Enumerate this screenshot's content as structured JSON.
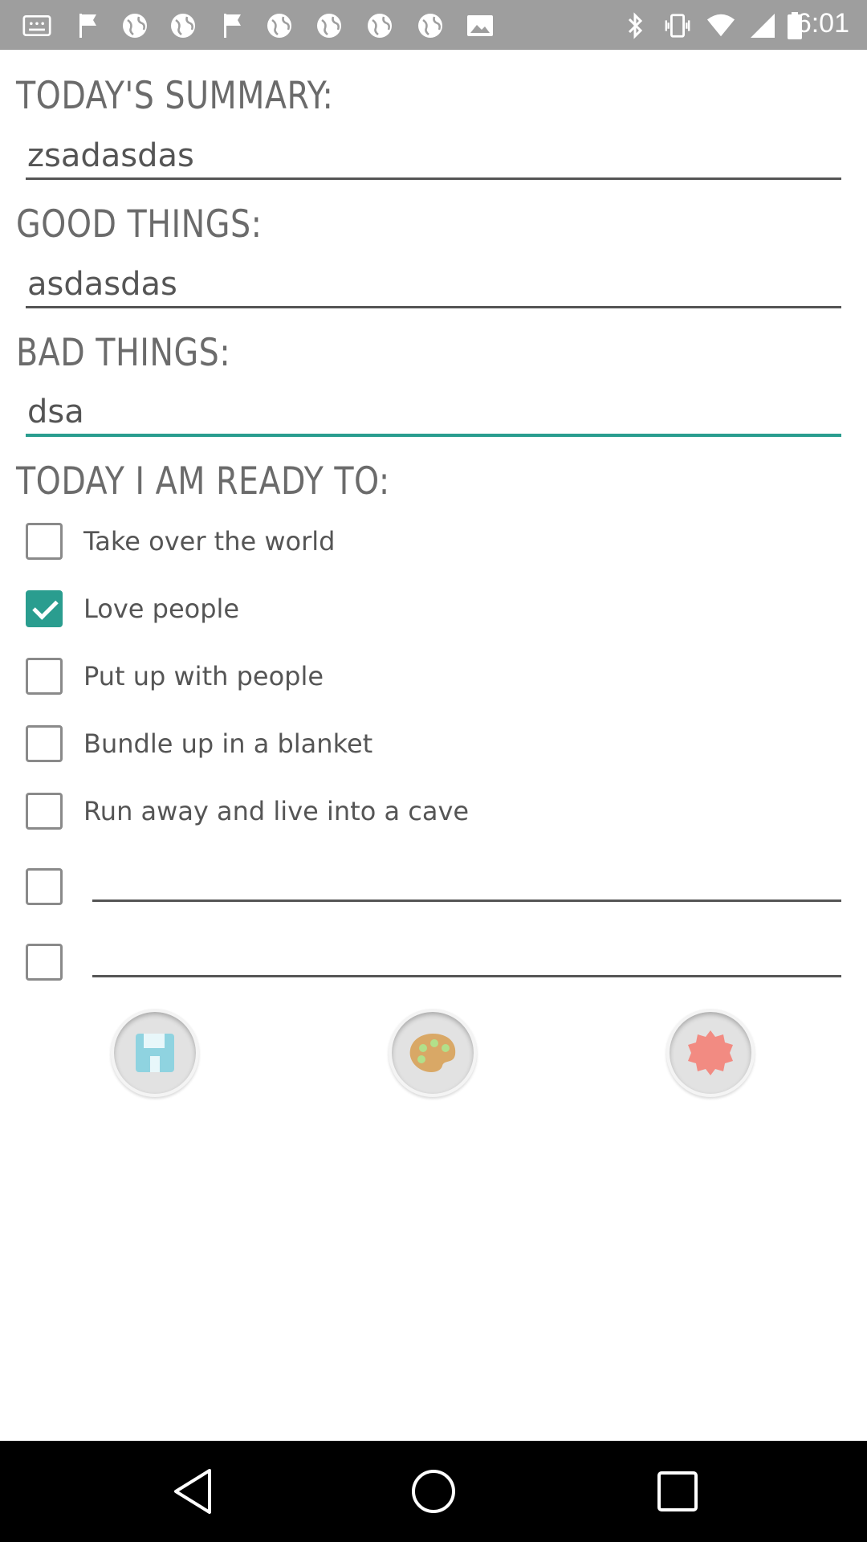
{
  "status_bar": {
    "time": "6:01",
    "left_icons": [
      "notification-icon",
      "flag-icon",
      "globe-icon",
      "globe-icon",
      "flag-icon",
      "globe-icon",
      "globe-icon",
      "globe-icon",
      "image-icon"
    ],
    "right_icons": [
      "bluetooth-icon",
      "vibrate-icon",
      "wifi-icon",
      "signal-icon",
      "battery-icon"
    ]
  },
  "summary": {
    "label": "TODAY'S SUMMARY:",
    "value": "zsadasdas"
  },
  "good": {
    "label": "GOOD THINGS:",
    "value": "asdasdas"
  },
  "bad": {
    "label": "BAD THINGS:",
    "value": "dsa"
  },
  "ready": {
    "label": "TODAY I AM READY TO:",
    "options": [
      {
        "text": "Take over the world",
        "checked": false
      },
      {
        "text": "Love people",
        "checked": true
      },
      {
        "text": "Put up with people",
        "checked": false
      },
      {
        "text": "Bundle up in a blanket",
        "checked": false
      },
      {
        "text": "Run away and live into a cave",
        "checked": false
      }
    ],
    "custom_1": "",
    "custom_2": ""
  },
  "actions": [
    "save-icon",
    "palette-icon",
    "badge-icon"
  ],
  "accent": "#2a9d8f"
}
